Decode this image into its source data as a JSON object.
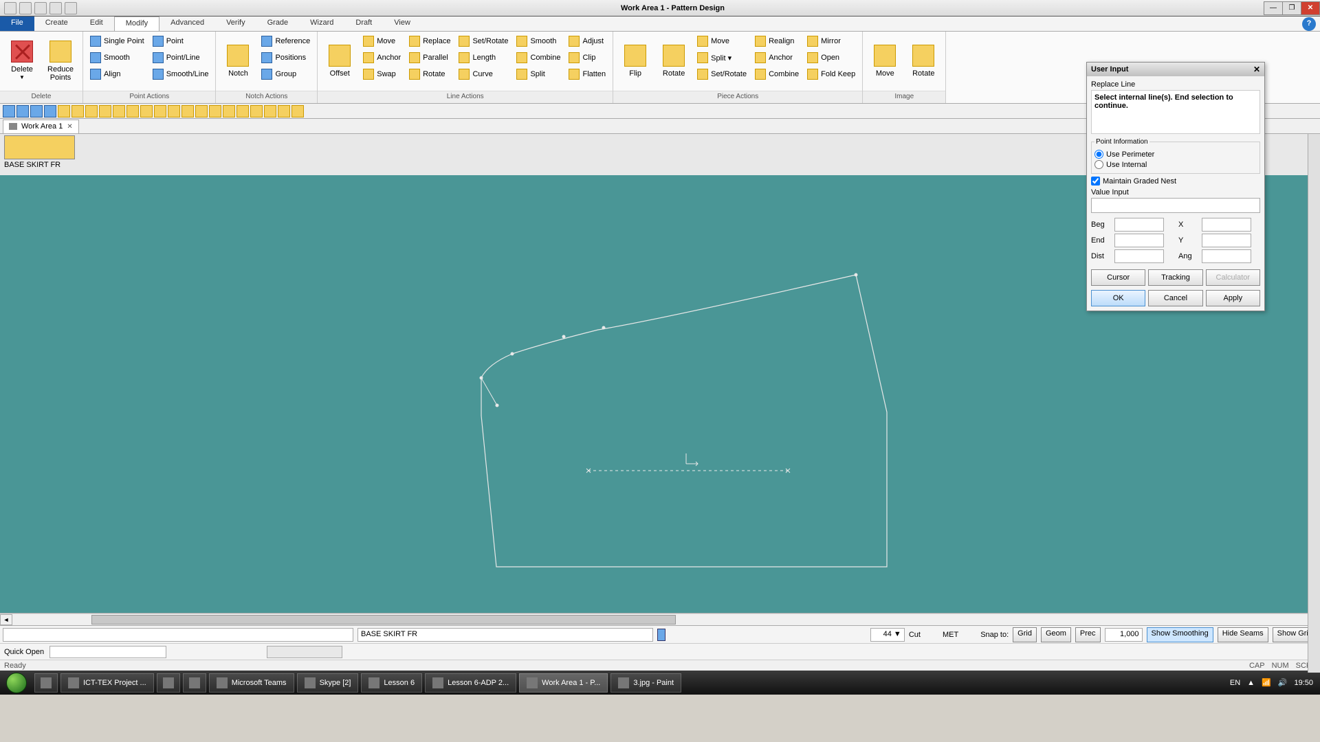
{
  "title": "Work Area 1 - Pattern Design",
  "menus": {
    "file": "File",
    "items": [
      "Create",
      "Edit",
      "Modify",
      "Advanced",
      "Verify",
      "Grade",
      "Wizard",
      "Draft",
      "View"
    ],
    "active": "Modify"
  },
  "ribbon": {
    "delete_group": {
      "big1": "Delete",
      "big2": "Reduce\nPoints",
      "label": "Delete"
    },
    "point_actions": {
      "label": "Point Actions",
      "col1": [
        "Single Point",
        "Smooth",
        "Align"
      ],
      "col2": [
        "Point",
        "Point/Line",
        "Smooth/Line"
      ]
    },
    "notch_actions": {
      "label": "Notch Actions",
      "big": "Notch",
      "col": [
        "Reference",
        "Positions",
        "Group"
      ]
    },
    "line_actions": {
      "label": "Line Actions",
      "big": "Offset",
      "col1": [
        "Move",
        "Anchor",
        "Swap"
      ],
      "col2": [
        "Replace",
        "Parallel",
        "Rotate"
      ],
      "col3": [
        "Set/Rotate",
        "Length",
        "Curve"
      ],
      "col4": [
        "Smooth",
        "Combine",
        "Split"
      ],
      "col5": [
        "Adjust",
        "Clip",
        "Flatten"
      ]
    },
    "piece_actions": {
      "label": "Piece Actions",
      "big1": "Flip",
      "big2": "Rotate",
      "col1": [
        "Move",
        "Split ▾",
        "Set/Rotate"
      ],
      "col2": [
        "Realign",
        "Anchor",
        "Combine"
      ],
      "col3": [
        "Mirror",
        "Open",
        "Fold Keep"
      ]
    },
    "image": {
      "label": "Image",
      "big1": "Move",
      "big2": "Rotate"
    }
  },
  "doctab": {
    "name": "Work Area 1"
  },
  "piece": {
    "name": "BASE SKIRT FR"
  },
  "panel": {
    "title": "User Input",
    "command": "Replace Line",
    "message": "Select internal line(s). End selection to continue.",
    "point_info": "Point Information",
    "use_perimeter": "Use Perimeter",
    "use_internal": "Use Internal",
    "maintain": "Maintain Graded Nest",
    "value_input": "Value Input",
    "beg": "Beg",
    "end": "End",
    "dist": "Dist",
    "x": "X",
    "y": "Y",
    "ang": "Ang",
    "cursor": "Cursor",
    "tracking": "Tracking",
    "calculator": "Calculator",
    "ok": "OK",
    "cancel": "Cancel",
    "apply": "Apply"
  },
  "status": {
    "piece_name": "BASE SKIRT FR",
    "size_sel": "44",
    "cut": "Cut",
    "met": "MET",
    "snap": "Snap to:",
    "grid": "Grid",
    "geom": "Geom",
    "prec": "Prec",
    "prec_val": "1,000",
    "show_smoothing": "Show Smoothing",
    "hide_seams": "Hide Seams",
    "show_grid": "Show Grid",
    "quick_open": "Quick Open",
    "ready": "Ready",
    "cap": "CAP",
    "num": "NUM",
    "scrl": "SCRL"
  },
  "taskbar": {
    "items": [
      "ICT-TEX Project ...",
      "",
      "",
      "Microsoft Teams",
      "Skype [2]",
      "Lesson 6",
      "Lesson 6-ADP 2...",
      "Work Area 1 - P...",
      "3.jpg - Paint"
    ],
    "active": "Work Area 1 - P...",
    "lang": "EN",
    "time": "19:50"
  }
}
